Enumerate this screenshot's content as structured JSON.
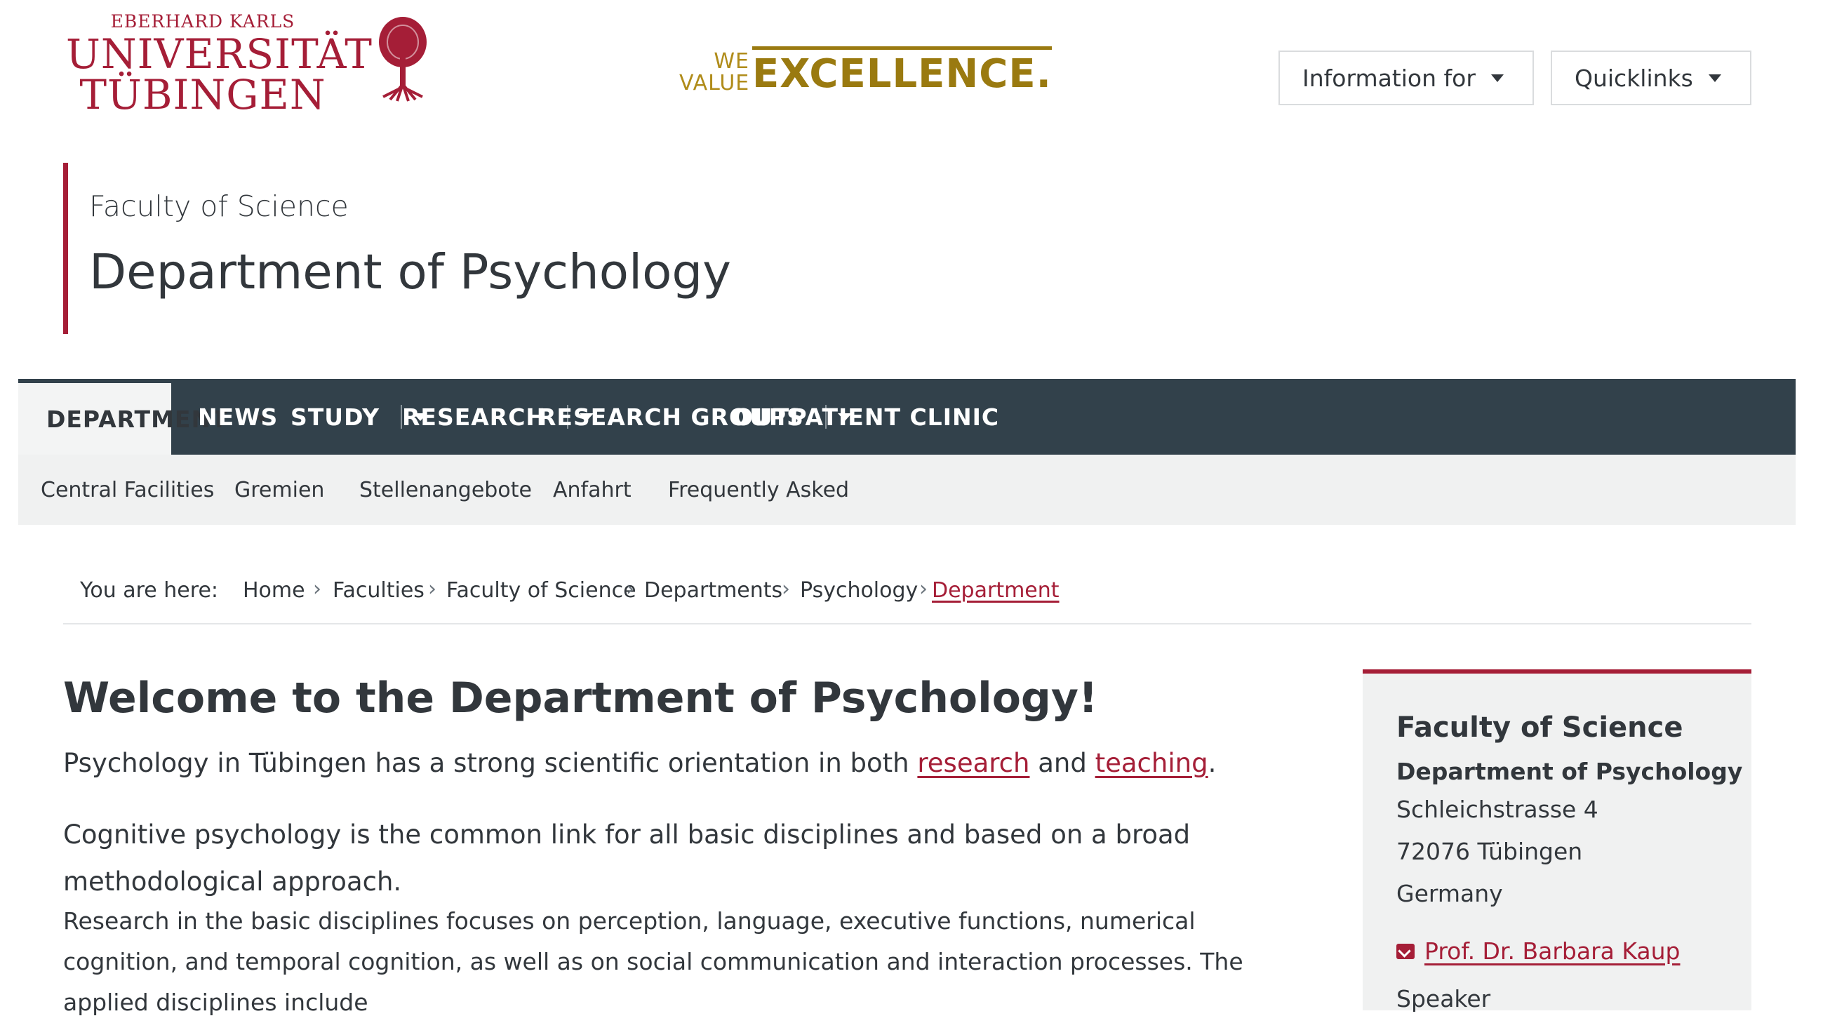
{
  "header": {
    "logo": {
      "line1": "EBERHARD KARLS",
      "line2": "UNIVERSITÄT",
      "line3": "TÜBINGEN"
    },
    "slogan": {
      "we": "WE",
      "value": "VALUE",
      "excellence": "EXCELLENCE."
    },
    "buttons": {
      "information_for": "Information for",
      "quicklinks": "Quicklinks"
    }
  },
  "title_block": {
    "faculty": "Faculty of Science",
    "department": "Department of Psychology"
  },
  "main_nav": [
    {
      "label": "DEPARTMENT"
    },
    {
      "label": "NEWS"
    },
    {
      "label": "STUDY"
    },
    {
      "label": "RESEARCH"
    },
    {
      "label": "RESEARCH GROUPS"
    },
    {
      "label": "OUTPATIENT CLINIC"
    }
  ],
  "sub_nav": [
    {
      "label": "Central Facilities"
    },
    {
      "label": "Gremien"
    },
    {
      "label": "Stellenangebote"
    },
    {
      "label": "Anfahrt"
    },
    {
      "label": "Frequently Asked"
    }
  ],
  "breadcrumb": {
    "prefix": "You are here:",
    "items": [
      "Home",
      "Faculties",
      "Faculty of Science",
      "Departments",
      "Psychology",
      "Department"
    ]
  },
  "content": {
    "heading": "Welcome to the Department of Psychology!",
    "p1_before": "Psychology in Tübingen has a strong scientific orientation in both ",
    "p1_link1": "research",
    "p1_middle": " and ",
    "p1_link2": "teaching",
    "p1_after": ".",
    "p2": "Cognitive psychology is the common link for all basic disciplines and based on a broad methodological approach.",
    "p3": "Research in the basic disciplines focuses on perception, language, executive functions, numerical cognition, and temporal cognition, as well as on social communication and interaction processes. The applied disciplines include"
  },
  "sidebar": {
    "faculty": "Faculty of Science",
    "department": "Department of Psychology",
    "street": "Schleichstrasse 4",
    "city": "72076 Tübingen",
    "country": "Germany",
    "contact_name": "Prof. Dr. Barbara Kaup",
    "contact_role": "Speaker"
  },
  "colors": {
    "brand_red": "#a51e37",
    "gold": "#9a7a10",
    "nav_bg": "#32414b"
  }
}
